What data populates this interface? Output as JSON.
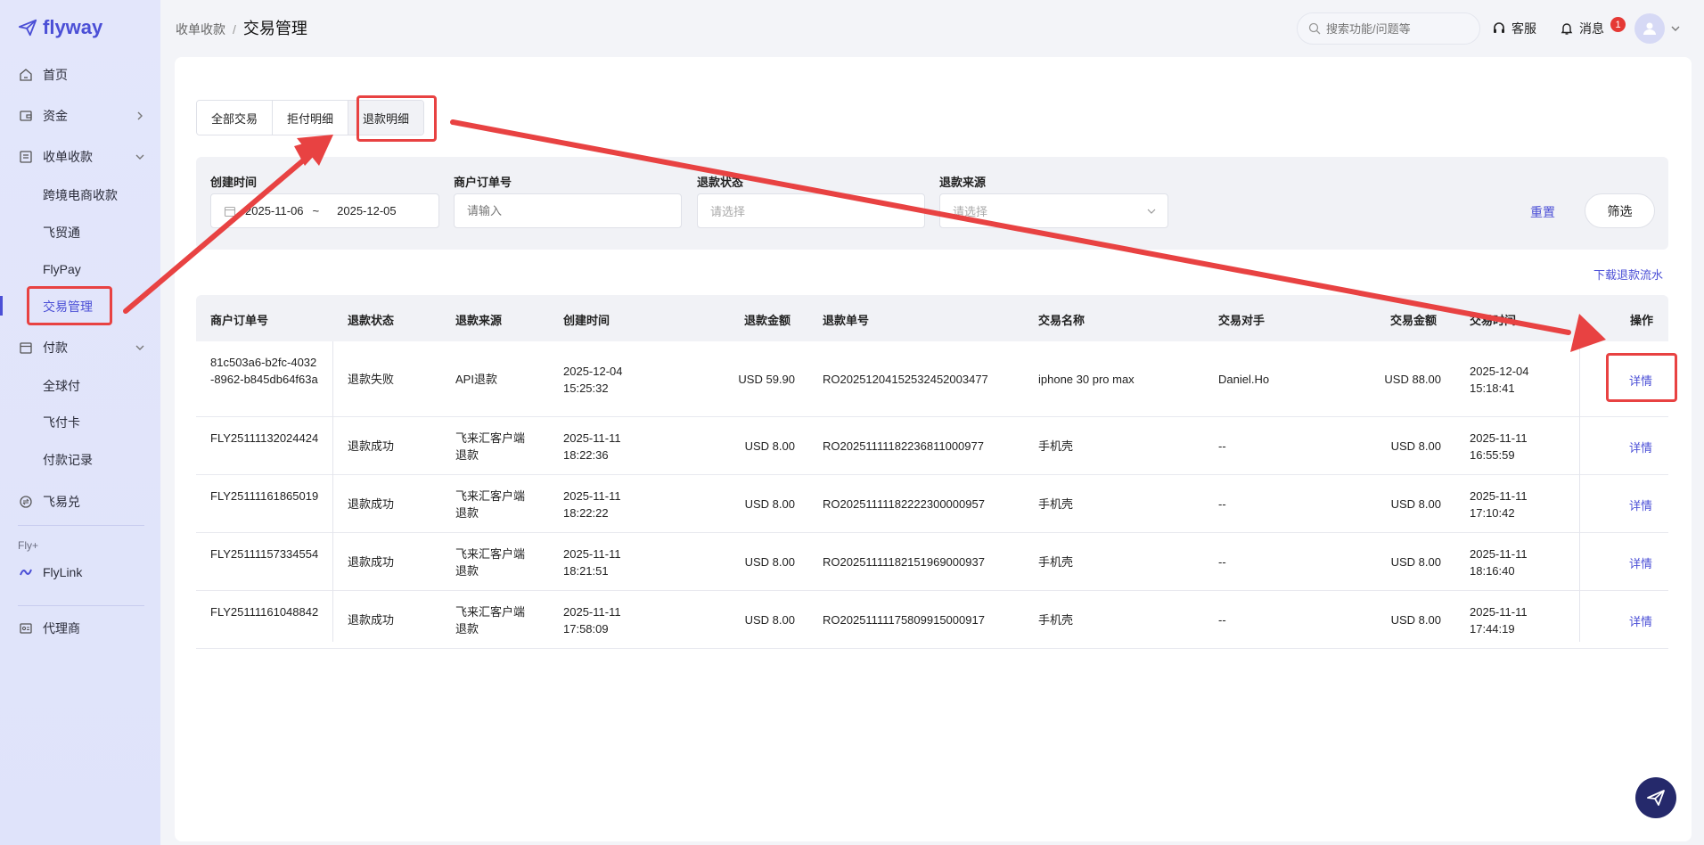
{
  "app": {
    "logo_text": "flyway"
  },
  "sidebar": {
    "items": [
      {
        "label": "首页",
        "icon": "home-icon"
      },
      {
        "label": "资金",
        "icon": "wallet-icon"
      },
      {
        "label": "收单收款",
        "icon": "receipt-icon"
      },
      {
        "label": "付款",
        "icon": "calendar-icon"
      },
      {
        "label": "飞易兑",
        "icon": "exchange-icon"
      },
      {
        "label": "FlyLink",
        "icon": "link-icon"
      },
      {
        "label": "代理商",
        "icon": "agent-card-icon"
      }
    ],
    "sub_collect": [
      "跨境电商收款",
      "飞贸通",
      "FlyPay",
      "交易管理"
    ],
    "sub_pay": [
      "全球付",
      "飞付卡",
      "付款记录"
    ],
    "group_label": "Fly+",
    "accent_color": "#4b4fd6"
  },
  "header": {
    "breadcrumb_parent": "收单收款",
    "breadcrumb_sep": "/",
    "breadcrumb_current": "交易管理",
    "search_placeholder": "搜索功能/问题等",
    "service_label": "客服",
    "message_label": "消息",
    "message_badge": "1"
  },
  "tabs": [
    "全部交易",
    "拒付明细",
    "退款明细"
  ],
  "filters": {
    "created_label": "创建时间",
    "date_start": "2025-11-06",
    "date_sep": "~",
    "date_end": "2025-12-05",
    "order_label": "商户订单号",
    "order_placeholder": "请输入",
    "status_label": "退款状态",
    "status_placeholder": "请选择",
    "source_label": "退款来源",
    "source_placeholder": "请选择",
    "reset_label": "重置",
    "filter_label": "筛选"
  },
  "download_label": "下载退款流水",
  "table": {
    "headers": [
      "商户订单号",
      "退款状态",
      "退款来源",
      "创建时间",
      "退款金额",
      "退款单号",
      "交易名称",
      "交易对手",
      "交易金额",
      "交易时间",
      "操作"
    ],
    "rows": [
      {
        "order": "81c503a6-b2fc-4032-8962-b845db64f63a",
        "status": "退款失败",
        "source": "API退款",
        "created_date": "2025-12-04",
        "created_time": "15:25:32",
        "refund_amount": "USD 59.90",
        "refund_no": "RO20251204152532452003477",
        "trade_name": "iphone 30 pro max",
        "counterparty": "Daniel.Ho",
        "trade_amount": "USD 88.00",
        "trade_date": "2025-12-04",
        "trade_time": "15:18:41",
        "action": "详情"
      },
      {
        "order": "FLY25111132024424",
        "status": "退款成功",
        "source": "飞来汇客户端退款",
        "created_date": "2025-11-11",
        "created_time": "18:22:36",
        "refund_amount": "USD 8.00",
        "refund_no": "RO20251111182236811000977",
        "trade_name": "手机壳",
        "counterparty": "--",
        "trade_amount": "USD 8.00",
        "trade_date": "2025-11-11",
        "trade_time": "16:55:59",
        "action": "详情"
      },
      {
        "order": "FLY25111161865019",
        "status": "退款成功",
        "source": "飞来汇客户端退款",
        "created_date": "2025-11-11",
        "created_time": "18:22:22",
        "refund_amount": "USD 8.00",
        "refund_no": "RO20251111182222300000957",
        "trade_name": "手机壳",
        "counterparty": "--",
        "trade_amount": "USD 8.00",
        "trade_date": "2025-11-11",
        "trade_time": "17:10:42",
        "action": "详情"
      },
      {
        "order": "FLY25111157334554",
        "status": "退款成功",
        "source": "飞来汇客户端退款",
        "created_date": "2025-11-11",
        "created_time": "18:21:51",
        "refund_amount": "USD 8.00",
        "refund_no": "RO20251111182151969000937",
        "trade_name": "手机壳",
        "counterparty": "--",
        "trade_amount": "USD 8.00",
        "trade_date": "2025-11-11",
        "trade_time": "18:16:40",
        "action": "详情"
      },
      {
        "order": "FLY25111161048842",
        "status": "退款成功",
        "source": "飞来汇客户端退款",
        "created_date": "2025-11-11",
        "created_time": "17:58:09",
        "refund_amount": "USD 8.00",
        "refund_no": "RO20251111175809915000917",
        "trade_name": "手机壳",
        "counterparty": "--",
        "trade_amount": "USD 8.00",
        "trade_date": "2025-11-11",
        "trade_time": "17:44:19",
        "action": "详情"
      }
    ]
  },
  "annotation_color": "#e84242"
}
